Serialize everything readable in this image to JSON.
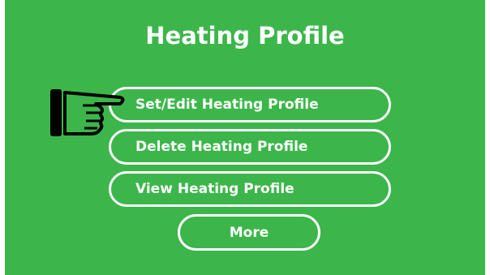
{
  "title": "Heating Profile",
  "menu": {
    "set_edit": "Set/Edit Heating Profile",
    "delete": "Delete Heating Profile",
    "view": "View Heating Profile",
    "more": "More"
  },
  "selection_indicator": {
    "icon": "pointing-hand-icon",
    "selected_item": "Set/Edit Heating Profile"
  },
  "colors": {
    "background": "#3cb64a",
    "foreground": "#ffffff"
  }
}
